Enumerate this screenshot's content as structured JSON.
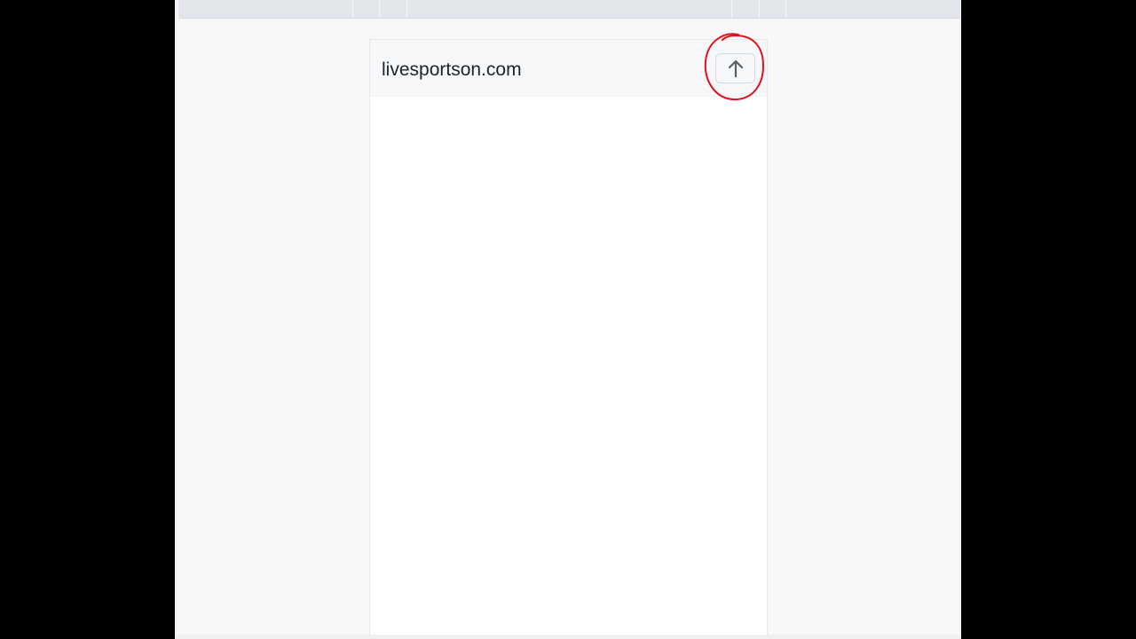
{
  "popup": {
    "domain": "livesportson.com",
    "up_button": {
      "icon": "arrow-up-icon"
    }
  },
  "annotation": {
    "shape": "circle",
    "color": "#e0121b"
  },
  "colors": {
    "background": "#f8f8f9",
    "top_strip": "#e2e5ea",
    "popup_header": "#f6f7f9",
    "text": "#1f2328",
    "icon": "#5a5f66"
  }
}
